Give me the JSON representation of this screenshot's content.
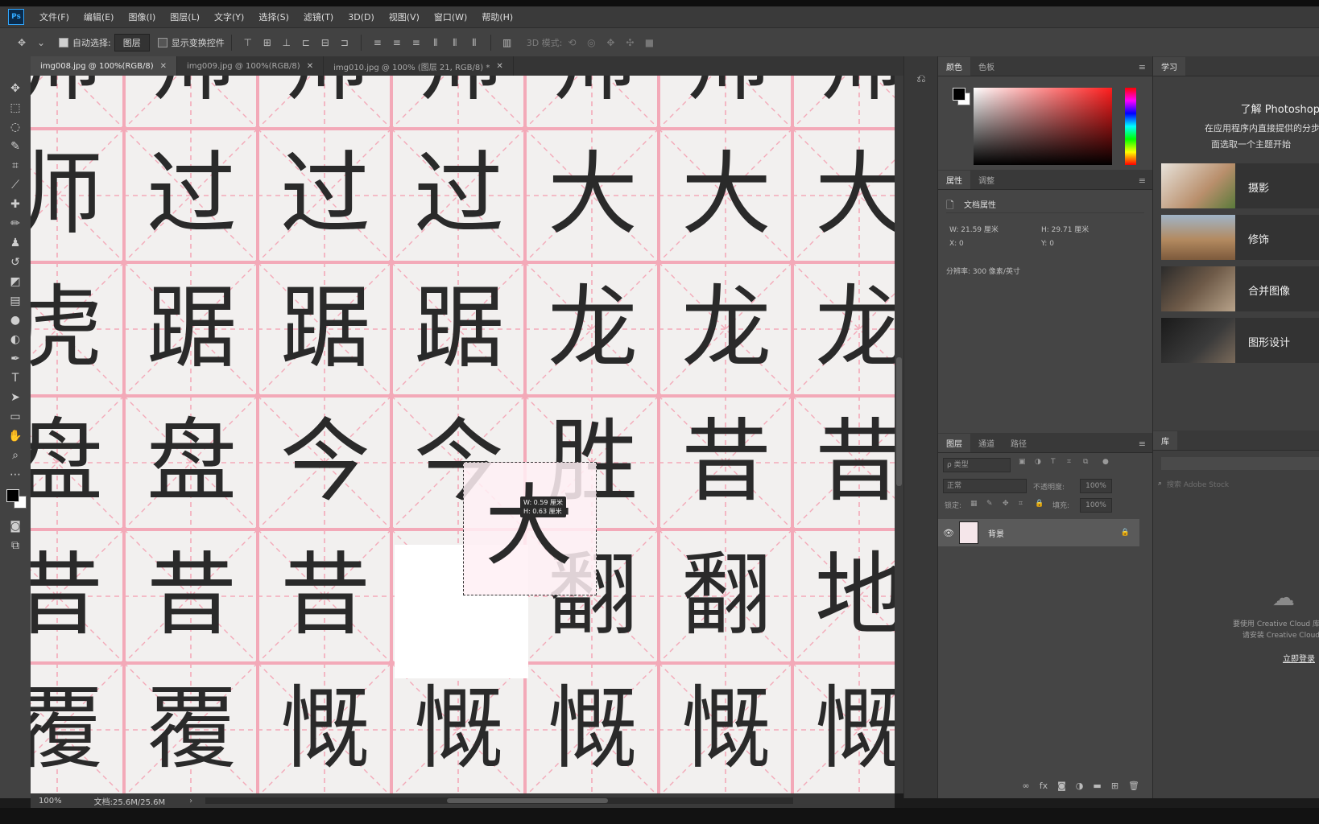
{
  "app": {
    "logo": "Ps"
  },
  "menu": [
    "文件(F)",
    "编辑(E)",
    "图像(I)",
    "图层(L)",
    "文字(Y)",
    "选择(S)",
    "滤镜(T)",
    "3D(D)",
    "视图(V)",
    "窗口(W)",
    "帮助(H)"
  ],
  "options": {
    "auto_select_label": "自动选择:",
    "auto_select_value": "图层",
    "show_transform_label": "显示变换控件",
    "mode_3d_label": "3D 模式:"
  },
  "tabs": [
    {
      "label": "img008.jpg @ 100%(RGB/8)",
      "active": true
    },
    {
      "label": "img009.jpg @ 100%(RGB/8)",
      "active": false
    },
    {
      "label": "img010.jpg @ 100% (图层 21, RGB/8) *",
      "active": false
    }
  ],
  "canvas": {
    "rows": [
      [
        "师",
        "师",
        "师",
        "师",
        "师",
        "师",
        "师"
      ],
      [
        "师",
        "过",
        "过",
        "过",
        "大",
        "大",
        "大"
      ],
      [
        "虎",
        "踞",
        "踞",
        "踞",
        "龙",
        "龙",
        "龙"
      ],
      [
        "盘",
        "盘",
        "今",
        "今",
        "胜",
        "昔",
        "昔"
      ],
      [
        "昔",
        "昔",
        "昔",
        "",
        "翻",
        "翻",
        "地"
      ],
      [
        "覆",
        "覆",
        "慨",
        "慨",
        "慨",
        "慨",
        "慨"
      ]
    ],
    "floating_char": "大",
    "tooltip_w": "W: 0.59 厘米",
    "tooltip_h": "H: 0.63 厘米"
  },
  "status": {
    "zoom": "100%",
    "doc": "文档:25.6M/25.6M"
  },
  "color_panel": {
    "tabs": [
      "颜色",
      "色板"
    ]
  },
  "properties_panel": {
    "tabs": [
      "属性",
      "调整"
    ],
    "title": "文档属性",
    "w": "W:  21.59 厘米",
    "h": "H:  29.71 厘米",
    "x": "X:  0",
    "y": "Y:  0",
    "resolution": "分辨率: 300 像素/英寸"
  },
  "layers_panel": {
    "tabs": [
      "图层",
      "通道",
      "路径"
    ],
    "filter": "ρ 类型",
    "blend": "正常",
    "opacity_label": "不透明度:",
    "opacity_value": "100%",
    "lock_label": "锁定:",
    "fill_label": "填充:",
    "fill_value": "100%",
    "layer_name": "背景"
  },
  "learn_panel": {
    "tab": "学习",
    "title": "了解 Photoshop",
    "desc1": "在应用程序内直接提供的分步",
    "desc2": "面选取一个主题开始",
    "cards": [
      "摄影",
      "修饰",
      "合并图像",
      "图形设计"
    ]
  },
  "library_panel": {
    "tab": "库",
    "search_placeholder": "搜索 Adobe Stock",
    "cc_text1": "要使用 Creative Cloud 库",
    "cc_text2": "请安装 Creative Cloud",
    "link": "立即登录"
  },
  "colors": {
    "accent": "#31a8ff",
    "grid_pink": "#f2a3b3"
  }
}
